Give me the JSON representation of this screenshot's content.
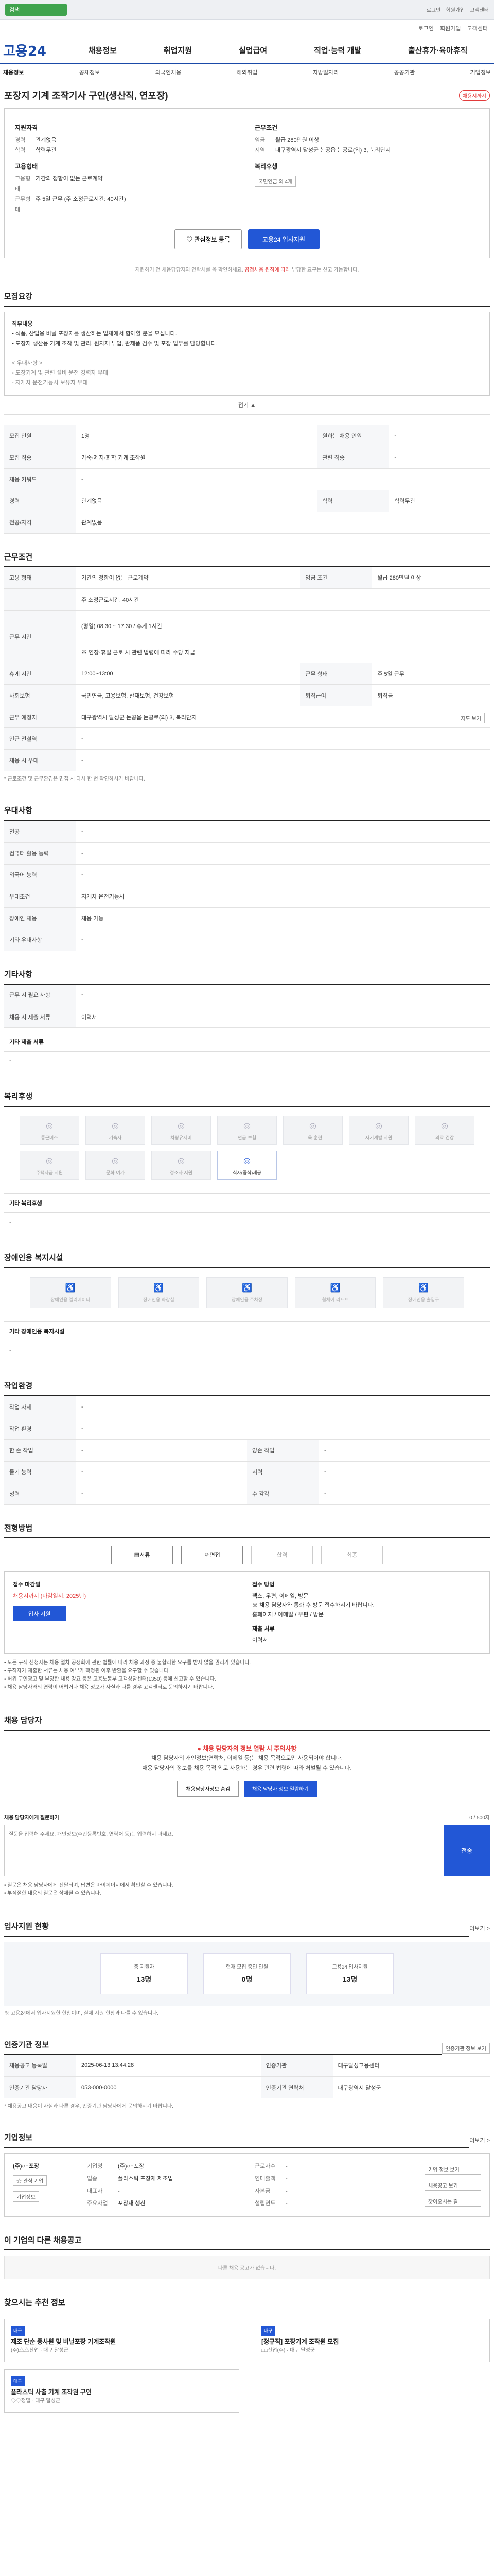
{
  "topbar": {
    "search_label": "검색",
    "links": [
      "로그인",
      "회원가입",
      "고객센터"
    ]
  },
  "util": {
    "items": [
      "로그인",
      "회원가입",
      "고객센터"
    ]
  },
  "header": {
    "logo": "고용24",
    "gnb": [
      "채용정보",
      "취업지원",
      "실업급여",
      "직업·능력 개발",
      "출산휴가·육아휴직"
    ]
  },
  "subnav": {
    "items": [
      "채용정보",
      "공채정보",
      "외국인채용",
      "해외취업",
      "지방일자리",
      "공공기관",
      "기업정보"
    ]
  },
  "job": {
    "title": "포장지 기계 조작기사 구인(생산직, 연포장)",
    "badge": "채용시까지"
  },
  "summary": {
    "left_head": "지원자격",
    "left_rows": [
      {
        "k": "경력",
        "v": "관계없음"
      },
      {
        "k": "학력",
        "v": "학력무관"
      }
    ],
    "left_head2": "고용형태",
    "left_rows2": [
      {
        "k": "고용형태",
        "v": "기간의 정함이 없는 근로계약"
      },
      {
        "k": "근무형태",
        "v": "주 5일 근무 (주 소정근로시간: 40시간)"
      }
    ],
    "right_head": "근무조건",
    "right_rows": [
      {
        "k": "임금",
        "v": "월급 280만원 이상"
      },
      {
        "k": "지역",
        "v": "대구광역시 달성군 논공읍 논공로(외) 3, 북리단지"
      }
    ],
    "right_head2": "복리후생",
    "right_chip": "국민연금 외 4개",
    "btn_favorite": "관심정보 등록",
    "btn_apply": "고용24 입사지원",
    "note_prefix": "지원하기 전 채용담당자의 연락처를 꼭 확인하세요.",
    "note_red": "공정채용 원칙에 따라",
    "note_suffix": "부당한 요구는 신고 가능합니다."
  },
  "overview": {
    "title": "모집요강",
    "duty_head": "직무내용",
    "duty_lines": [
      "• 식품, 산업용 비닐 포장지를 생산하는 업체에서 함께할 분을 모십니다.",
      "• 포장지 생산용 기계 조작 및 관리, 원자재 투입, 완제품 검수 및 포장 업무를 담당합니다."
    ],
    "pref_head": "< 우대사항 >",
    "pref_lines": [
      "- 포장기계 및 관련 설비 운전 경력자 우대",
      "- 지게차 운전기능사 보유자 우대"
    ],
    "fold": "접기 ▲",
    "rows": [
      [
        {
          "k": "모집 인원",
          "v": "1명"
        },
        {
          "k": "원하는 채용 인원",
          "v": "-"
        }
      ],
      [
        {
          "k": "모집 직종",
          "v": "가죽·제지·화학 기계 조작원"
        },
        {
          "k": "관련 직종",
          "v": "-"
        }
      ],
      [
        {
          "k": "채용 키워드",
          "v": "-"
        },
        {
          "k": "",
          "v": ""
        }
      ],
      [
        {
          "k": "경력",
          "v": "관계없음"
        },
        {
          "k": "학력",
          "v": "학력무관"
        }
      ],
      [
        {
          "k": "전공/자격",
          "v": "관계없음"
        },
        {
          "k": "",
          "v": ""
        }
      ]
    ]
  },
  "conditions": {
    "title": "근무조건",
    "rows": [
      {
        "k": "고용 형태",
        "v": "기간의 정함이 없는 근로계약",
        "k2": "임금 조건",
        "v2": "월급 280만원 이상"
      },
      {
        "k": "",
        "v": "주 소정근로시간: 40시간",
        "k2": "",
        "v2": ""
      },
      {
        "k": "근무 시간",
        "v": "(평일) 08:30 ~ 17:30 / 휴게 1시간",
        "k2": "",
        "v2": ""
      },
      {
        "k": "",
        "v": "※ 연장·휴일 근로 시 관련 법령에 따라 수당 지급",
        "k2": "",
        "v2": ""
      },
      {
        "k": "휴게 시간",
        "v": "12:00~13:00",
        "k2": "근무 형태",
        "v2": "주 5일 근무"
      },
      {
        "k": "사회보험",
        "v": "국민연금, 고용보험, 산재보험, 건강보험",
        "k2": "퇴직급여",
        "v2": "퇴직금"
      },
      {
        "k": "근무 예정지",
        "v": "대구광역시 달성군 논공읍 논공로(외) 3, 북리단지",
        "k2": "",
        "v2": "지도 보기"
      },
      {
        "k": "인근 전철역",
        "v": "-",
        "k2": "",
        "v2": ""
      },
      {
        "k": "채용 시 우대",
        "v": "-",
        "k2": "",
        "v2": ""
      }
    ],
    "note": "* 근로조건 및 근무환경은 면접 시 다시 한 번 확인하시기 바랍니다."
  },
  "extra": {
    "title": "우대사항",
    "rows": [
      {
        "k": "전공",
        "v": "-"
      },
      {
        "k": "컴퓨터 활용 능력",
        "v": "-"
      },
      {
        "k": "외국어 능력",
        "v": "-"
      },
      {
        "k": "우대조건",
        "v": "지게차 운전기능사"
      },
      {
        "k": "장애인 채용",
        "v": "채용 가능"
      },
      {
        "k": "기타 우대사항",
        "v": "-"
      }
    ]
  },
  "other": {
    "title": "기타사항",
    "rows": [
      {
        "k": "근무 시 필요 사항",
        "v": "-"
      },
      {
        "k": "채용 시 제출 서류",
        "v": "이력서"
      }
    ],
    "sub": "기타 제출 서류",
    "sub_body": "-"
  },
  "welfare": {
    "title": "복리후생",
    "items": [
      {
        "label": "통근버스",
        "on": false
      },
      {
        "label": "기숙사",
        "on": false
      },
      {
        "label": "차량유지비",
        "on": false
      },
      {
        "label": "연금·보험",
        "on": false
      },
      {
        "label": "교육·훈련",
        "on": false
      },
      {
        "label": "자기계발 지원",
        "on": false
      },
      {
        "label": "의료·건강",
        "on": false
      },
      {
        "label": "주택자금 지원",
        "on": false
      },
      {
        "label": "문화·여가",
        "on": false
      },
      {
        "label": "경조사 지원",
        "on": false
      },
      {
        "label": "식사(중식)제공",
        "on": true
      }
    ],
    "sub": "기타 복리후생",
    "sub_body": "-"
  },
  "disability": {
    "title": "장애인용 복지시설",
    "items": [
      "장애인용 엘리베이터",
      "장애인용 화장실",
      "장애인용 주차장",
      "휠체어 리프트",
      "장애인용 출입구"
    ],
    "sub": "기타 장애인용 복지시설",
    "sub_body": "-"
  },
  "env": {
    "title": "작업환경",
    "rows": [
      {
        "k": "작업 자세",
        "v": "-",
        "k2": "",
        "v2": ""
      },
      {
        "k": "작업 환경",
        "v": "-",
        "k2": "",
        "v2": ""
      },
      {
        "k": "한 손 작업",
        "v": "-",
        "k2": "양손 작업",
        "v2": "-"
      },
      {
        "k": "들기 능력",
        "v": "-",
        "k2": "시력",
        "v2": "-"
      },
      {
        "k": "청력",
        "v": "-",
        "k2": "수 감각",
        "v2": "-"
      }
    ]
  },
  "method": {
    "title": "전형방법",
    "tabs": [
      "서류",
      "면접",
      "합격",
      "최종"
    ],
    "receipt_head": "접수 마감일",
    "receipt_value": "채용시까지 (마감일시: 2025년)",
    "way_head": "접수 방법",
    "way_lines": [
      "팩스, 우편, 이메일, 방문",
      "※ 채용 담당자와 통화 후 방문 접수하시기 바랍니다.",
      "홈페이지 / 이메일 / 우편 / 방문"
    ],
    "apply_btn": "입사 지원",
    "docs_head": "제출 서류",
    "docs_value": "이력서"
  },
  "method_notes": [
    "• 모든 구직 신청자는 채용 절차 공정화에 관한 법률에 따라 채용 과정 중 불합리한 요구를 받지 않을 권리가 있습니다.",
    "• 구직자가 제출한 서류는 채용 여부가 확정된 이후 반환을 요구할 수 있습니다.",
    "• 허위 구인광고 및 부당한 채용 강요 등은 고용노동부 고객상담센터(1350) 등에 신고할 수 있습니다.",
    "• 채용 담당자와의 연락이 어렵거나 채용 정보가 사실과 다를 경우 고객센터로 문의하시기 바랍니다."
  ],
  "manager": {
    "title": "채용 담당자",
    "alert_title": "● 채용 담당자의 정보 열람 시 주의사항",
    "alert_lines": [
      "채용 담당자의 개인정보(연락처, 이메일 등)는 채용 목적으로만 사용되어야 합니다.",
      "채용 담당자의 정보를 채용 목적 외로 사용하는 경우 관련 법령에 따라 처벌될 수 있습니다."
    ],
    "btn_hide": "채용담당자정보 숨김",
    "btn_show": "채용 담당자 정보 열람하기",
    "inquiry_head": "채용 담당자에게 질문하기",
    "inquiry_count": "0 / 500자",
    "inquiry_placeholder": "질문을 입력해 주세요. 개인정보(주민등록번호, 연락처 등)는 입력하지 마세요.",
    "inquiry_btn": "전송",
    "inquiry_notes": [
      "• 질문은 채용 담당자에게 전달되며, 답변은 마이페이지에서 확인할 수 있습니다.",
      "• 부적절한 내용의 질문은 삭제될 수 있습니다."
    ]
  },
  "stats": {
    "title": "입사지원 현황",
    "more": "더보기 >",
    "cards": [
      {
        "label": "총 지원자",
        "value": "13명"
      },
      {
        "label": "현재 모집 중인 인원",
        "value": "0명"
      },
      {
        "label": "고용24 입사지원",
        "value": "13명"
      }
    ],
    "note": "※ 고용24에서 입사지원한 현황이며, 실제 지원 현황과 다를 수 있습니다."
  },
  "agency": {
    "title": "인증기관 정보",
    "more": "인증기관 정보 보기",
    "rows": [
      {
        "k": "채용공고 등록일",
        "v": "2025-06-13 13:44:28",
        "k2": "인증기관",
        "v2": "대구달성고용센터"
      },
      {
        "k": "인증기관 담당자",
        "v": "053-000-0000",
        "k2": "인증기관 연락처",
        "v2": "대구광역시 달성군"
      }
    ],
    "note": "* 채용공고 내용이 사실과 다른 경우, 인증기관 담당자에게 문의하시기 바랍니다."
  },
  "company": {
    "title": "기업정보",
    "more": "더보기 >",
    "name": "(주)○○포장",
    "btn_fav": "관심 기업",
    "btn_more": "기업정보",
    "info": [
      {
        "k": "기업명",
        "v": "(주)○○포장"
      },
      {
        "k": "근로자수",
        "v": "-"
      },
      {
        "k": "업종",
        "v": "플라스틱 포장재 제조업"
      },
      {
        "k": "연매출액",
        "v": "-"
      },
      {
        "k": "대표자",
        "v": "-"
      },
      {
        "k": "자본금",
        "v": "-"
      },
      {
        "k": "주요사업",
        "v": "포장재 생산"
      },
      {
        "k": "설립연도",
        "v": "-"
      }
    ],
    "side_btns": [
      "기업 정보 보기",
      "채용공고 보기",
      "찾아오시는 길"
    ]
  },
  "same_company": {
    "title": "이 기업의 다른 채용공고",
    "empty": "다른 채용 공고가 없습니다."
  },
  "recommend": {
    "title": "찾으시는 추천 정보",
    "cards": [
      {
        "tag": "대구",
        "title": "제조 단순 종사원 및 비닐포장 기계조작원",
        "meta": "(주)△△산업 · 대구 달성군"
      },
      {
        "tag": "대구",
        "title": "[정규직] 포장기계 조작원 모집",
        "meta": "□□산업(주) · 대구 달성군"
      },
      {
        "tag": "대구",
        "title": "플라스틱 사출 기계 조작원 구인",
        "meta": "◇◇정밀 · 대구 달성군"
      }
    ]
  }
}
